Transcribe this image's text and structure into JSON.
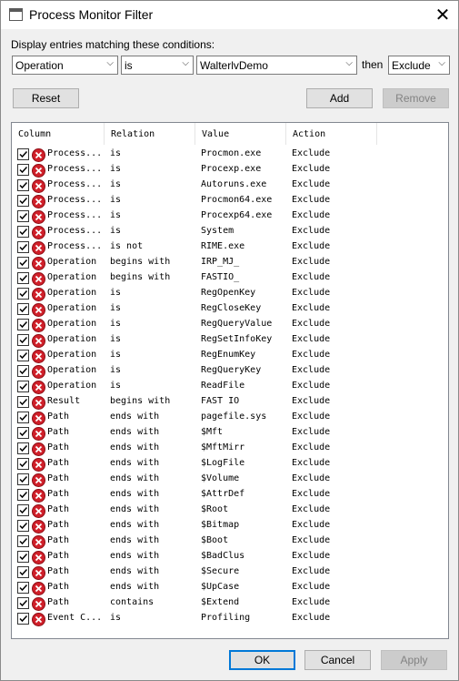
{
  "window": {
    "title": "Process Monitor Filter"
  },
  "conditions": {
    "label": "Display entries matching these conditions:",
    "column": "Operation",
    "relation": "is",
    "value": "WalterlvDemo",
    "then_label": "then",
    "action": "Exclude"
  },
  "buttons": {
    "reset": "Reset",
    "add": "Add",
    "remove": "Remove",
    "ok": "OK",
    "cancel": "Cancel",
    "apply": "Apply"
  },
  "table": {
    "headers": [
      "Column",
      "Relation",
      "Value",
      "Action"
    ],
    "rows": [
      [
        "Process...",
        "is",
        "Procmon.exe",
        "Exclude"
      ],
      [
        "Process...",
        "is",
        "Procexp.exe",
        "Exclude"
      ],
      [
        "Process...",
        "is",
        "Autoruns.exe",
        "Exclude"
      ],
      [
        "Process...",
        "is",
        "Procmon64.exe",
        "Exclude"
      ],
      [
        "Process...",
        "is",
        "Procexp64.exe",
        "Exclude"
      ],
      [
        "Process...",
        "is",
        "System",
        "Exclude"
      ],
      [
        "Process...",
        "is not",
        "RIME.exe",
        "Exclude"
      ],
      [
        "Operation",
        "begins with",
        "IRP_MJ_",
        "Exclude"
      ],
      [
        "Operation",
        "begins with",
        "FASTIO_",
        "Exclude"
      ],
      [
        "Operation",
        "is",
        "RegOpenKey",
        "Exclude"
      ],
      [
        "Operation",
        "is",
        "RegCloseKey",
        "Exclude"
      ],
      [
        "Operation",
        "is",
        "RegQueryValue",
        "Exclude"
      ],
      [
        "Operation",
        "is",
        "RegSetInfoKey",
        "Exclude"
      ],
      [
        "Operation",
        "is",
        "RegEnumKey",
        "Exclude"
      ],
      [
        "Operation",
        "is",
        "RegQueryKey",
        "Exclude"
      ],
      [
        "Operation",
        "is",
        "ReadFile",
        "Exclude"
      ],
      [
        "Result",
        "begins with",
        "FAST IO",
        "Exclude"
      ],
      [
        "Path",
        "ends with",
        "pagefile.sys",
        "Exclude"
      ],
      [
        "Path",
        "ends with",
        "$Mft",
        "Exclude"
      ],
      [
        "Path",
        "ends with",
        "$MftMirr",
        "Exclude"
      ],
      [
        "Path",
        "ends with",
        "$LogFile",
        "Exclude"
      ],
      [
        "Path",
        "ends with",
        "$Volume",
        "Exclude"
      ],
      [
        "Path",
        "ends with",
        "$AttrDef",
        "Exclude"
      ],
      [
        "Path",
        "ends with",
        "$Root",
        "Exclude"
      ],
      [
        "Path",
        "ends with",
        "$Bitmap",
        "Exclude"
      ],
      [
        "Path",
        "ends with",
        "$Boot",
        "Exclude"
      ],
      [
        "Path",
        "ends with",
        "$BadClus",
        "Exclude"
      ],
      [
        "Path",
        "ends with",
        "$Secure",
        "Exclude"
      ],
      [
        "Path",
        "ends with",
        "$UpCase",
        "Exclude"
      ],
      [
        "Path",
        "contains",
        "$Extend",
        "Exclude"
      ],
      [
        "Event C...",
        "is",
        "Profiling",
        "Exclude"
      ]
    ]
  },
  "icons": {
    "row_checkbox": "checkbox-checked-icon",
    "row_status": "exclude-x-icon"
  },
  "colors": {
    "exclude_red": "#d0202a",
    "default_button_border": "#0078d7"
  }
}
